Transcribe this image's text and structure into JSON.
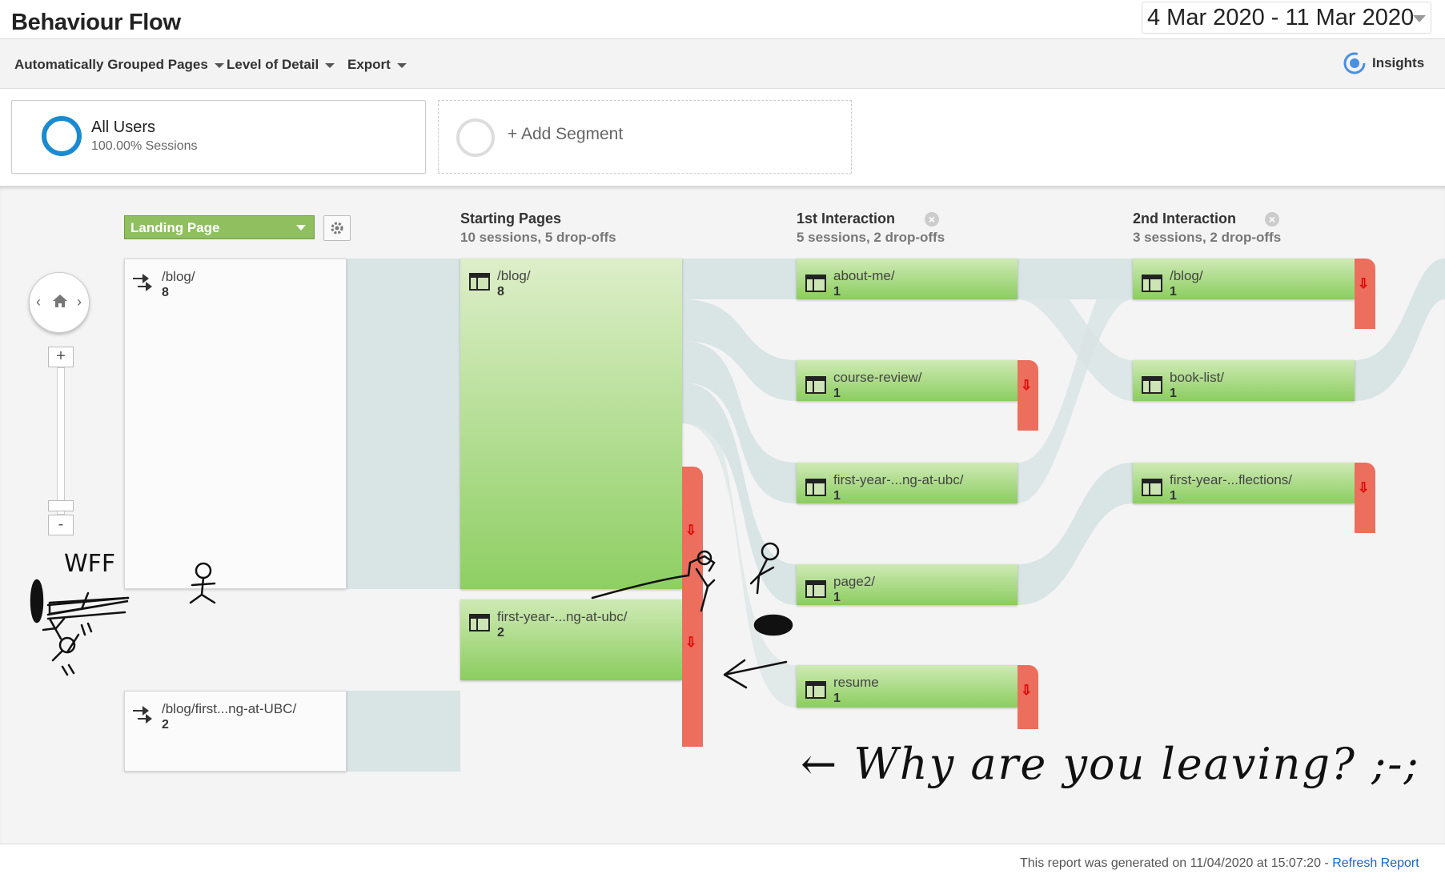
{
  "header": {
    "title": "Behaviour Flow",
    "date_range": "4 Mar 2020 - 11 Mar 2020"
  },
  "toolbar": {
    "grouping": "Automatically Grouped Pages",
    "level": "Level of Detail",
    "export": "Export",
    "insights": "Insights"
  },
  "segments": {
    "all_users_name": "All Users",
    "all_users_sub": "100.00% Sessions",
    "add_segment": "+ Add Segment"
  },
  "flow": {
    "dimension": "Landing Page",
    "columns": [
      {
        "title": "Starting Pages",
        "sub": "10 sessions, 5 drop-offs"
      },
      {
        "title": "1st Interaction",
        "sub": "5 sessions, 2 drop-offs"
      },
      {
        "title": "2nd Interaction",
        "sub": "3 sessions, 2 drop-offs"
      }
    ],
    "landing": [
      {
        "label": "/blog/",
        "count": "8"
      },
      {
        "label": "/blog/first...ng-at-UBC/",
        "count": "2"
      }
    ],
    "starting": [
      {
        "label": "/blog/",
        "count": "8"
      },
      {
        "label": "first-year-...ng-at-ubc/",
        "count": "2"
      }
    ],
    "first": [
      {
        "label": "about-me/",
        "count": "1"
      },
      {
        "label": "course-review/",
        "count": "1"
      },
      {
        "label": "first-year-...ng-at-ubc/",
        "count": "1"
      },
      {
        "label": "page2/",
        "count": "1"
      },
      {
        "label": "resume",
        "count": "1"
      }
    ],
    "second": [
      {
        "label": "/blog/",
        "count": "1"
      },
      {
        "label": "book-list/",
        "count": "1"
      },
      {
        "label": "first-year-...flections/",
        "count": "1"
      }
    ]
  },
  "annotations": {
    "note": "← Why are you leaving? ;-;",
    "wtf": "WFF"
  },
  "footer": {
    "generated": "This report was generated on 11/04/2020 at 15:07:20 - ",
    "refresh": "Refresh Report"
  },
  "colors": {
    "node_green": "#8ecf63",
    "dropoff_red": "#ec6e5d",
    "segment_blue": "#1a8bd0",
    "flow_gray": "#d6e2e2"
  }
}
